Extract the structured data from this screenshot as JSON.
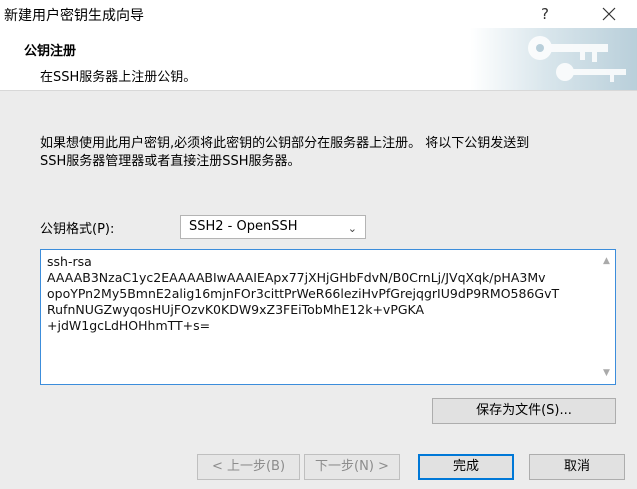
{
  "window": {
    "title": "新建用户密钥生成向导",
    "help_label": "?"
  },
  "header": {
    "title": "公钥注册",
    "subtitle": "在SSH服务器上注册公钥。"
  },
  "main": {
    "description_line1": "如果想使用此用户密钥,必须将此密钥的公钥部分在服务器上注册。 将以下公钥发送到",
    "description_line2": "SSH服务器管理器或者直接注册SSH服务器。",
    "format_label": "公钥格式(P):",
    "format_selected": "SSH2 - OpenSSH",
    "public_key": "ssh-rsa\nAAAAB3NzaC1yc2EAAAABIwAAAIEApx77jXHjGHbFdvN/B0CrnLj/JVqXqk/pHA3Mv\nopoYPn2My5BmnE2alig16mjnFOr3cittPrWeR66leziHvPfGrejqgrIU9dP9RMO586GvT\nRufnNUGZwyqosHUjFOzvK0KDW9xZ3FEiTobMhE12k+vPGKA\n+jdW1gcLdHOHhmTT+s=",
    "save_button": "保存为文件(S)..."
  },
  "footer": {
    "back_button": "< 上一步(B)",
    "next_button": "下一步(N) >",
    "finish_button": "完成",
    "cancel_button": "取消"
  },
  "colors": {
    "accent": "#0078d7",
    "panel_bg": "#ececec"
  }
}
